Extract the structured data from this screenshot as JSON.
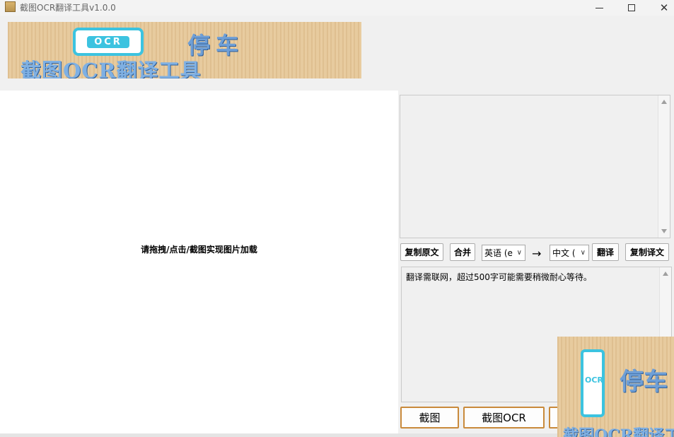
{
  "window": {
    "title": "截图OCR翻译工具v1.0.0",
    "icon": "app-icon",
    "controls": [
      "minimize-icon",
      "maximize-icon",
      "close-icon"
    ],
    "close_glyph": "✕"
  },
  "banner": {
    "logo_text": "OCR",
    "subtitle": "停车",
    "main_title": "截图OCR翻译工具"
  },
  "canvas": {
    "hint": "请拖拽/点击/截图实现图片加载"
  },
  "source_text": {
    "value": ""
  },
  "toolbar": {
    "copy_source_label": "复制原文",
    "merge_label": "合并",
    "source_lang": "英语 (e",
    "arrow": "→",
    "target_lang": "中文 (",
    "translate_label": "翻译",
    "copy_target_label": "复制译文",
    "combo_arrow": "∨"
  },
  "target_text": {
    "value": "翻译需联网，超过500字可能需要稍微耐心等待。"
  },
  "actions": {
    "screenshot_label": "截图",
    "screenshot_ocr_label": "截图OCR"
  },
  "thumbnail": {
    "logo_text": "OCR",
    "subtitle": "停车",
    "main_title": "截图OCR翻译工具"
  },
  "colors": {
    "accent_border": "#c98a3b",
    "logo_cyan": "#3cc3e0",
    "banner_text": "#7fb0e3"
  }
}
